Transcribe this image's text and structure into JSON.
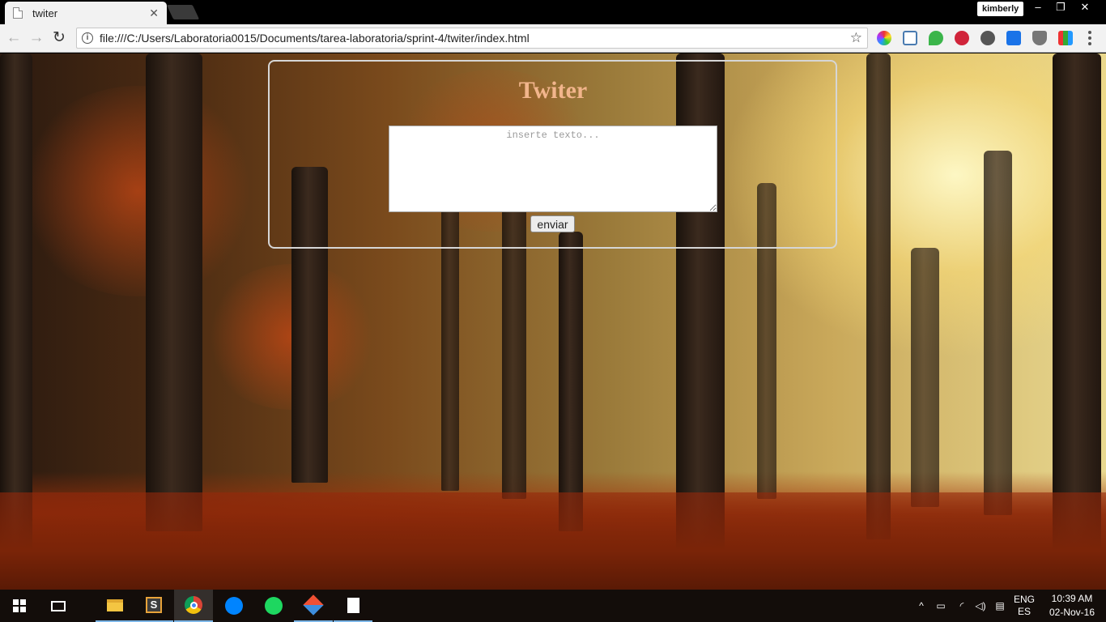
{
  "browser": {
    "tab_title": "twiter",
    "profile_name": "kimberly",
    "address": "file:///C:/Users/Laboratoria0015/Documents/tarea-laboratoria/sprint-4/twiter/index.html"
  },
  "app": {
    "title": "Twiter",
    "input_placeholder": "inserte texto...",
    "send_label": "enviar"
  },
  "taskbar": {
    "language": "ENG",
    "layout": "ES",
    "time": "10:39 AM",
    "date": "02-Nov-16"
  },
  "colors": {
    "title": "#f2b58c",
    "taskbar": "#140e0a",
    "active_indicator": "#7db7e8"
  }
}
